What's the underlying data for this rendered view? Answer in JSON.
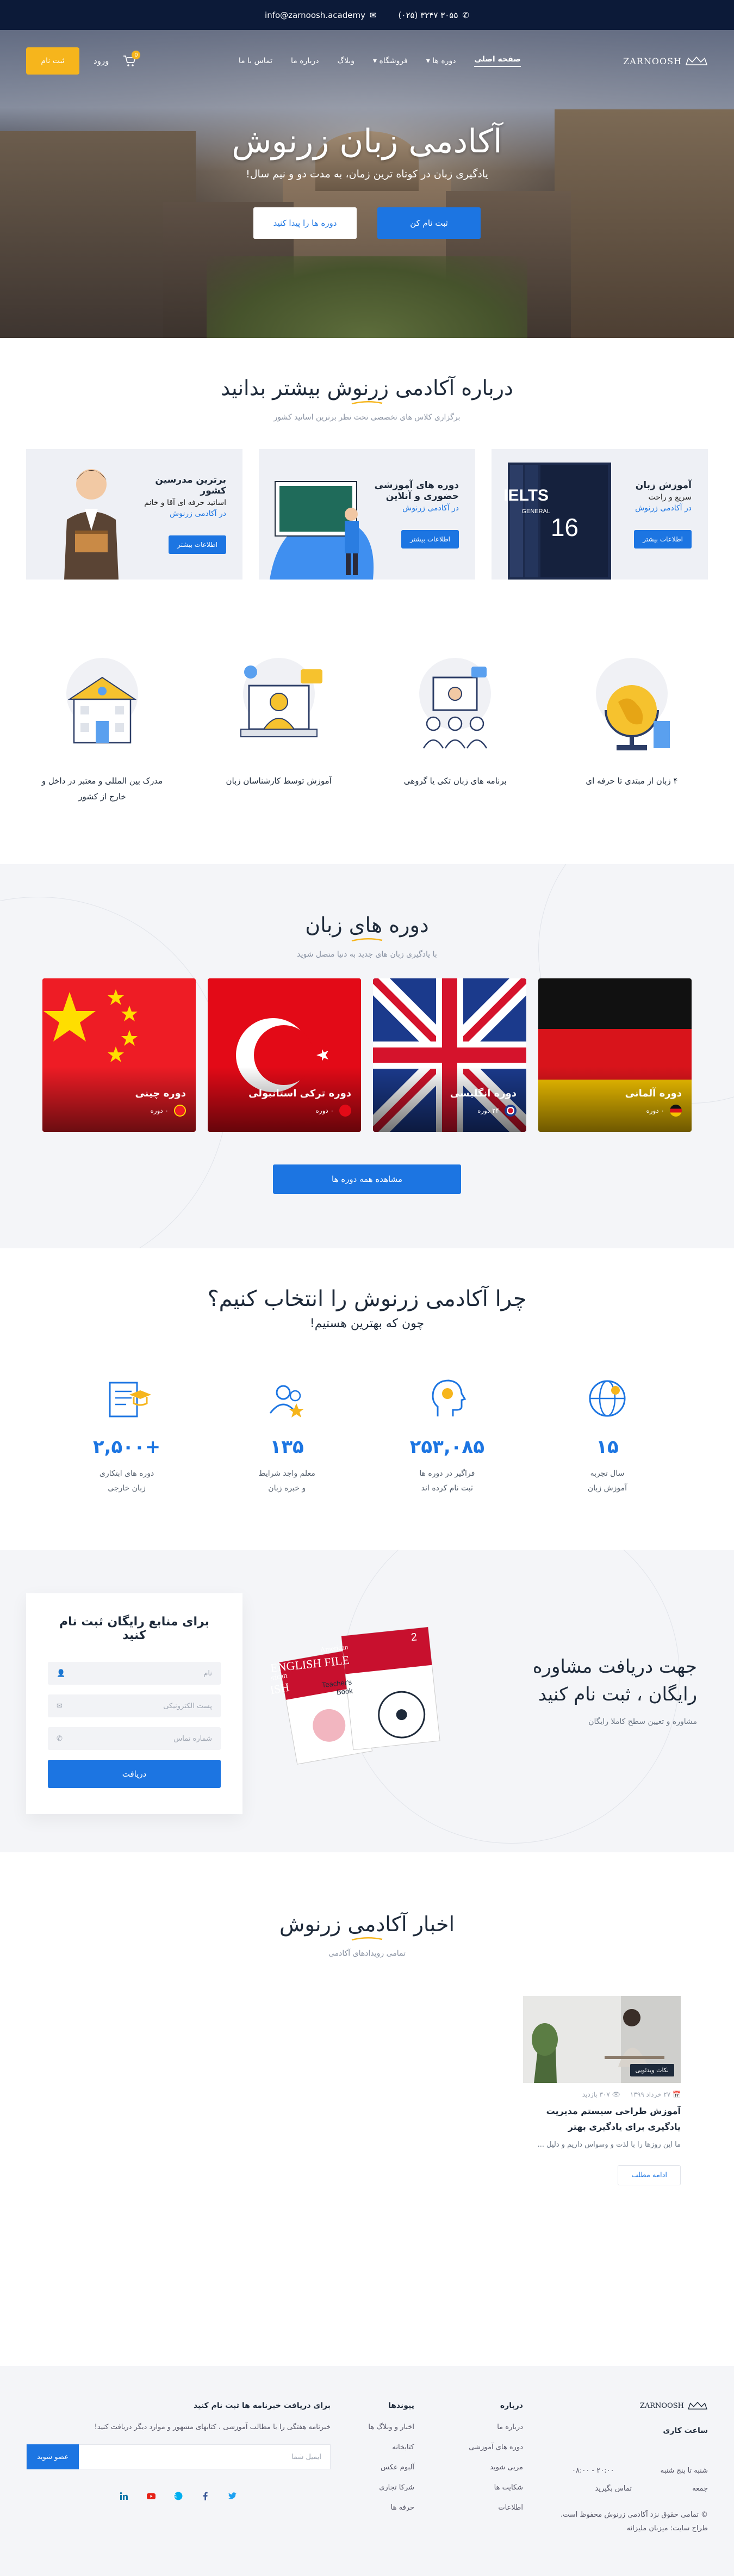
{
  "topbar": {
    "phone": "(۰۲۵) ۳۲۴۷ ۳۰۵۵",
    "email": "info@zarnoosh.academy"
  },
  "nav": {
    "logo": "ZARNOOSH",
    "items": [
      "صفحه اصلی",
      "دوره ها",
      "فروشگاه",
      "وبلاگ",
      "درباره ما",
      "تماس با ما"
    ],
    "login": "ورود",
    "register": "ثبت نام",
    "cart_count": "0"
  },
  "hero": {
    "title": "آکادمی زبان زرنوش",
    "subtitle": "یادگیری زبان در کوتاه ترین زمان، به مدت دو و نیم سال!",
    "primary_btn": "ثبت نام کن",
    "secondary_btn": "دوره ها را پیدا کنید"
  },
  "about": {
    "title": "درباره آکادمی زرنوش بیشتر بدانید",
    "subtitle": "برگزاری کلاس های تخصصی تحت نظر برترین اساتید کشور",
    "cards": [
      {
        "title": "آموزش زبان",
        "line1": "سریع و راحت",
        "line2": "در آکادمی زرنوش",
        "btn": "اطلاعات بیشتر"
      },
      {
        "title": "دوره های آموزشی حضوری و آنلاین",
        "line1": "",
        "line2": "در آکادمی زرنوش",
        "btn": "اطلاعات بیشتر"
      },
      {
        "title": "برترین مدرسین کشور",
        "line1": "اساتید حرفه ای آقا و خانم",
        "line2": "در آکادمی زرنوش",
        "btn": "اطلاعات بیشتر"
      }
    ],
    "features": [
      {
        "text": "۴ زبان از مبتدی تا حرفه ای"
      },
      {
        "text": "برنامه های زبان تکی یا گروهی"
      },
      {
        "text": "آموزش توسط کارشناسان زبان"
      },
      {
        "text": "مدرک بین المللی و معتبر در داخل و خارج از کشور"
      }
    ]
  },
  "courses": {
    "title": "دوره های زبان",
    "subtitle": "با یادگیری زبان های جدید به دنیا متصل شوید",
    "items": [
      {
        "name": "دوره آلمانی",
        "count": "۰ دوره"
      },
      {
        "name": "دوره انگلیسی",
        "count": "۲۴ دوره"
      },
      {
        "name": "دوره ترکی استانبولی",
        "count": "۰ دوره"
      },
      {
        "name": "دوره چینی",
        "count": "۰ دوره"
      }
    ],
    "view_all": "مشاهده همه دوره ها"
  },
  "why": {
    "title": "چرا آکادمی زرنوش را انتخاب کنیم؟",
    "subtitle": "چون که بهترین هستیم!",
    "stats": [
      {
        "num": "۱۵",
        "label1": "سال تجربه",
        "label2": "آموزش زبان"
      },
      {
        "num": "۲۵۳,۰۸۵",
        "label1": "فراگیر در دوره ها",
        "label2": "ثبت نام کرده اند"
      },
      {
        "num": "۱۳۵",
        "label1": "معلم واجد شرایط",
        "label2": "و خبره زبان"
      },
      {
        "num": "+۲,۵۰۰",
        "label1": "دوره های ابتکاری",
        "label2": "زبان خارجی"
      }
    ]
  },
  "signup": {
    "title": "جهت دریافت مشاوره رایگان ، ثبت نام کنید",
    "subtitle": "مشاوره و تعیین سطح کاملا رایگان",
    "form_title": "برای منابع رایگان ثبت نام کنید",
    "name_ph": "نام",
    "email_ph": "پست الکترونیکی",
    "phone_ph": "شماره تماس",
    "submit": "دریافت"
  },
  "news": {
    "title": "اخبار آکادمی زرنوش",
    "subtitle": "تمامی رویدادهای آکادمی",
    "post": {
      "tag": "نکات ویدئویی",
      "date": "۲۷ خرداد ۱۳۹۹",
      "views": "۳۰۷",
      "author": "بازدید",
      "title": "آموزش طراحی سیستم مدیریت یادگیری برای یادگیری بهتر",
      "excerpt": "ما این روزها را با لذت و وسواس داریم و دلیل ...",
      "btn": "ادامه مطلب"
    }
  },
  "footer": {
    "logo": "ZARNOOSH",
    "hours_title": "ساعت کاری",
    "hours_days": "شنبه تا پنج شنبه",
    "hours_time": "۰۸:۰۰ - ۲۰:۰۰",
    "friday": "جمعه",
    "friday_val": "تماس بگیرید",
    "copyright": "© تمامی حقوق نزد آکادمی زرنوش محفوظ است.",
    "credit": "طراح سایت: میزبان ملیزانه",
    "about_title": "درباره",
    "about_links": [
      "درباره ما",
      "دوره های آموزشی",
      "مربی شوید",
      "شکایت ها",
      "اطلاعات"
    ],
    "links_title": "پیوندها",
    "links": [
      "اخبار و وبلاگ ها",
      "کتابخانه",
      "آلبوم عکس",
      "شرکا تجاری",
      "حرفه ها"
    ],
    "nl_title": "برای دریافت خبرنامه ها ثبت نام کنید",
    "nl_text": "خبرنامه هفتگی را با مطالب آموزشی ، کتابهای مشهور و موارد دیگر دریافت کنید!",
    "nl_placeholder": "ایمیل شما",
    "nl_btn": "عضو شوید"
  }
}
